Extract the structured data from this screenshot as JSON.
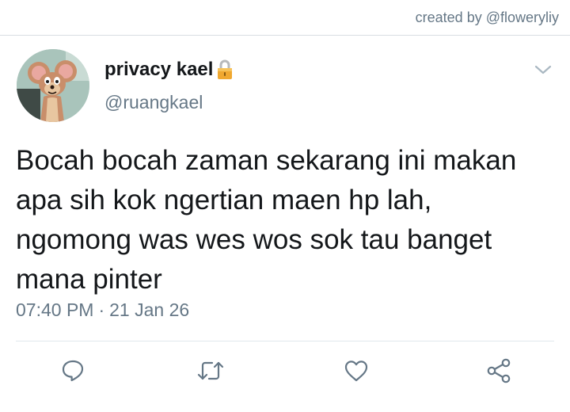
{
  "credit": {
    "text": "created by @floweryliy"
  },
  "tweet": {
    "display_name": "privacy kael",
    "handle": "@ruangkael",
    "text": "Bocah bocah zaman sekarang ini makan\napa sih kok ngertian maen hp lah,\nngomong was wes wos sok tau banget\nmana pinter",
    "time": "07:40 PM",
    "separator": "·",
    "date": "21 Jan 26"
  },
  "icons": {
    "lock": "lock-icon",
    "more": "chevron-down-icon",
    "reply": "comment-icon",
    "retweet": "retweet-icon",
    "like": "heart-icon",
    "share": "share-icon"
  },
  "colors": {
    "text": "#14171a",
    "secondary": "#657786",
    "divider": "#e1e8ed",
    "lock": "#f0a830"
  }
}
